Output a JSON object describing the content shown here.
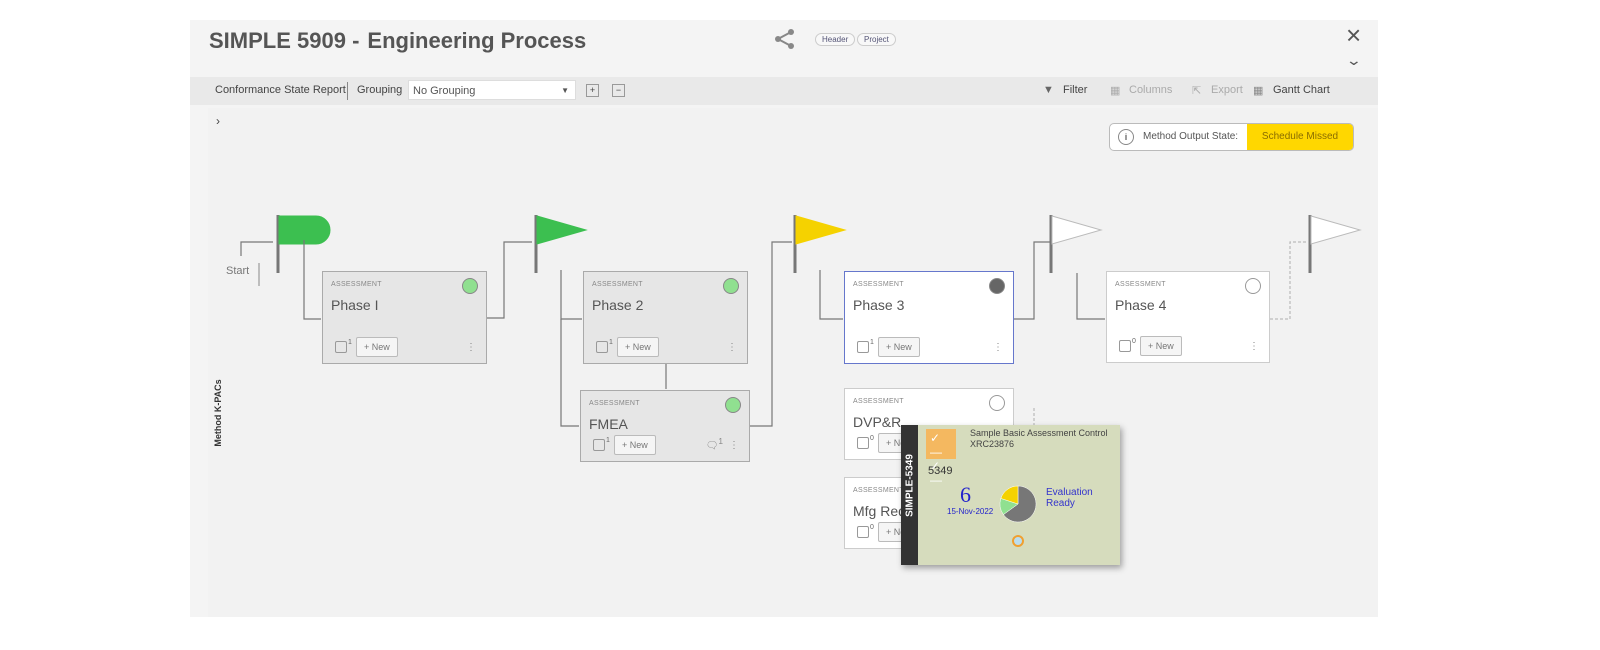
{
  "header": {
    "id": "SIMPLE 5909 -",
    "title": "Engineering Process",
    "pills": [
      "Header",
      "Project"
    ],
    "icons": [
      "share-icon",
      "close-icon",
      "chevron-down-icon"
    ]
  },
  "toolbar": {
    "report": "Conformance State Report",
    "grouping_label": "Grouping",
    "grouping_value": "No Grouping",
    "filter": "Filter",
    "columns": "Columns",
    "export": "Export",
    "gantt": "Gantt Chart"
  },
  "canvas": {
    "side_label": "Method K-PACs",
    "start": "Start",
    "state_label": "Method Output State:",
    "state_value": "Schedule Missed",
    "state_color": "#ffd700"
  },
  "cards": [
    {
      "kind": "ASSESSMENT",
      "name": "Phase I",
      "count": "1",
      "new": "+ New",
      "status": "#90e090"
    },
    {
      "kind": "ASSESSMENT",
      "name": "Phase 2",
      "count": "1",
      "new": "+ New",
      "status": "#90e090"
    },
    {
      "kind": "ASSESSMENT",
      "name": "FMEA",
      "count": "1",
      "new": "+ New",
      "comments": "1",
      "status": "#90e090"
    },
    {
      "kind": "ASSESSMENT",
      "name": "Phase 3",
      "count": "1",
      "new": "+ New",
      "status": "#666666"
    },
    {
      "kind": "ASSESSMENT",
      "name": "DVP&R",
      "count": "0",
      "new": "+ New",
      "status": "empty"
    },
    {
      "kind": "ASSESSMENT",
      "name": "Mfg Requirements",
      "count": "0",
      "new": "+ New",
      "status": "empty"
    },
    {
      "kind": "ASSESSMENT",
      "name": "Phase 4",
      "count": "0",
      "new": "+ New",
      "status": "empty"
    }
  ],
  "flags": [
    "#3cbf50",
    "#3cbf50",
    "#f5d200",
    "#ffffff",
    "#ffffff"
  ],
  "popup": {
    "strip": "SIMPLE-5349",
    "title": "Sample Basic Assessment Control",
    "code": "XRC23876",
    "id": "5349",
    "number": "6",
    "date": "15-Nov-2022",
    "status": "Evaluation Ready",
    "pie": [
      {
        "color": "#777777",
        "value": 65
      },
      {
        "color": "#90e090",
        "value": 15
      },
      {
        "color": "#f5d200",
        "value": 20
      }
    ]
  }
}
